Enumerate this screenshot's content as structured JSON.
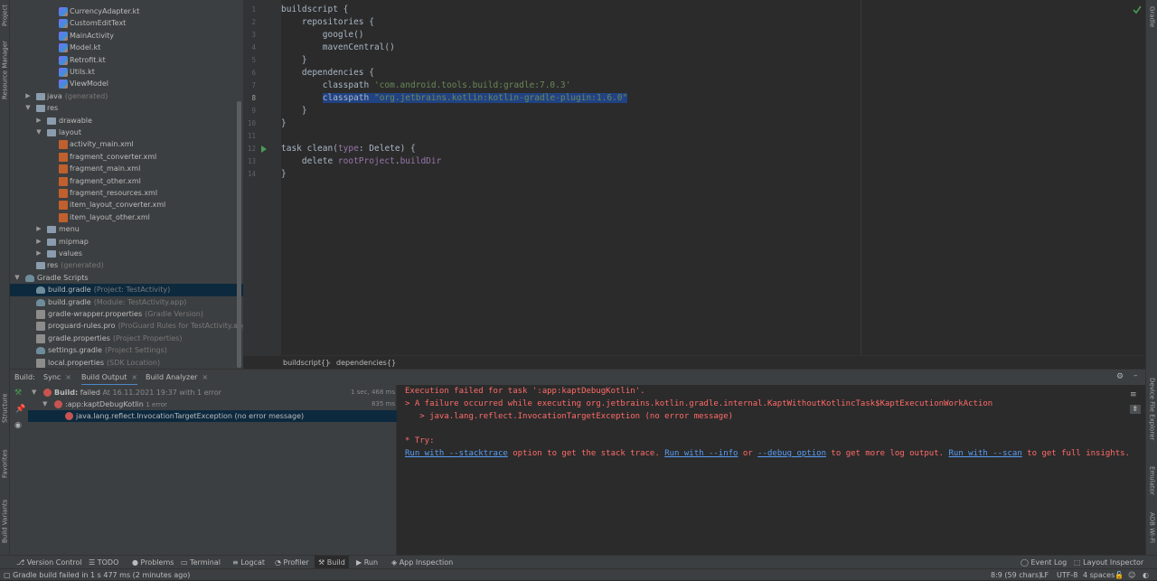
{
  "left_strip": {
    "project_tab": "Project",
    "resource_manager": "Resource Manager",
    "structure": "Structure",
    "favorites": "Favorites",
    "build_variants": "Build Variants"
  },
  "right_strip": {
    "gradle": "Gradle",
    "device_file_explorer": "Device File Explorer",
    "emulator": "Emulator",
    "adb_wifi": "ADB Wi-Fi"
  },
  "tree": [
    {
      "label": "CurrencyAdapter.kt",
      "sub": "",
      "icon": "kotlin-file-icon"
    },
    {
      "label": "CustomEditText",
      "sub": "",
      "icon": "kotlin-file-icon"
    },
    {
      "label": "MainActivity",
      "sub": "",
      "icon": "kotlin-file-icon"
    },
    {
      "label": "Model.kt",
      "sub": "",
      "icon": "kotlin-file-icon"
    },
    {
      "label": "Retrofit.kt",
      "sub": "",
      "icon": "kotlin-file-icon"
    },
    {
      "label": "Utils.kt",
      "sub": "",
      "icon": "kotlin-file-icon"
    },
    {
      "label": "ViewModel",
      "sub": "",
      "icon": "kotlin-file-icon"
    },
    {
      "label": "java",
      "sub": "(generated)",
      "icon": "folder-icon"
    },
    {
      "label": "res",
      "sub": "",
      "icon": "folder-icon"
    },
    {
      "label": "drawable",
      "sub": "",
      "icon": "folder-icon"
    },
    {
      "label": "layout",
      "sub": "",
      "icon": "folder-icon"
    },
    {
      "label": "activity_main.xml",
      "sub": "",
      "icon": "xml-file-icon"
    },
    {
      "label": "fragment_converter.xml",
      "sub": "",
      "icon": "xml-file-icon"
    },
    {
      "label": "fragment_main.xml",
      "sub": "",
      "icon": "xml-file-icon"
    },
    {
      "label": "fragment_other.xml",
      "sub": "",
      "icon": "xml-file-icon"
    },
    {
      "label": "fragment_resources.xml",
      "sub": "",
      "icon": "xml-file-icon"
    },
    {
      "label": "item_layout_converter.xml",
      "sub": "",
      "icon": "xml-file-icon"
    },
    {
      "label": "item_layout_other.xml",
      "sub": "",
      "icon": "xml-file-icon"
    },
    {
      "label": "menu",
      "sub": "",
      "icon": "folder-icon"
    },
    {
      "label": "mipmap",
      "sub": "",
      "icon": "folder-icon"
    },
    {
      "label": "values",
      "sub": "",
      "icon": "folder-icon"
    },
    {
      "label": "res",
      "sub": "(generated)",
      "icon": "folder-icon"
    },
    {
      "label": "Gradle Scripts",
      "sub": "",
      "icon": "gradle-icon"
    },
    {
      "label": "build.gradle",
      "sub": "(Project: TestActivity)",
      "icon": "gradle-icon"
    },
    {
      "label": "build.gradle",
      "sub": "(Module: TestActivity.app)",
      "icon": "gradle-icon"
    },
    {
      "label": "gradle-wrapper.properties",
      "sub": "(Gradle Version)",
      "icon": "properties-file-icon"
    },
    {
      "label": "proguard-rules.pro",
      "sub": "(ProGuard Rules for TestActivity.app)",
      "icon": "properties-file-icon"
    },
    {
      "label": "gradle.properties",
      "sub": "(Project Properties)",
      "icon": "properties-file-icon"
    },
    {
      "label": "settings.gradle",
      "sub": "(Project Settings)",
      "icon": "gradle-icon"
    },
    {
      "label": "local.properties",
      "sub": "(SDK Location)",
      "icon": "properties-file-icon"
    }
  ],
  "editor": {
    "line_numbers": [
      "1",
      "2",
      "3",
      "4",
      "5",
      "6",
      "7",
      "8",
      "9",
      "10",
      "11",
      "12",
      "13",
      "14"
    ],
    "lines": [
      {
        "t1": "buildscript {"
      },
      {
        "t1": "    repositories {"
      },
      {
        "t1": "        google()"
      },
      {
        "t1": "        mavenCentral()"
      },
      {
        "t1": "    }"
      },
      {
        "t1": "    dependencies {"
      },
      {
        "t1": "        classpath ",
        "t2": "'com.android.tools.build:gradle:7.0.3'"
      },
      {
        "t1": "classpath ",
        "t2": "\"org.jetbrains.kotlin:kotlin-gradle-plugin:1.6.0\""
      },
      {
        "t1": "    }"
      },
      {
        "t1": "}"
      },
      {
        "t1": ""
      },
      {
        "t1": "task ",
        "t2": "clean",
        "t3": "(",
        "t4": "type",
        "t5": ": Delete) {"
      },
      {
        "t1": "    delete ",
        "t2": "rootProject",
        "t3": ".",
        "t4": "buildDir"
      },
      {
        "t1": "}"
      }
    ],
    "breadcrumb": [
      "buildscript{}",
      "dependencies{}"
    ]
  },
  "build": {
    "tabs": {
      "build_label": "Build:",
      "sync": "Sync",
      "build_output": "Build Output",
      "build_analyzer": "Build Analyzer"
    },
    "rows": {
      "r1_bold": "Build:",
      "r1_rest": "failed",
      "r1_sub": "At 16.11.2021 19:37 with 1 error",
      "r1_time": "1 sec, 468 ms",
      "r2": ":app:kaptDebugKotlin",
      "r2_sub": "1 error",
      "r2_time": "835 ms",
      "r3": "java.lang.reflect.InvocationTargetException (no error message)"
    },
    "console": {
      "l1": "Execution failed for task ':app:kaptDebugKotlin'.",
      "l2": "> A failure occurred while executing org.jetbrains.kotlin.gradle.internal.KaptWithoutKotlincTask$KaptExecutionWorkAction",
      "l3": "   > java.lang.reflect.InvocationTargetException (no error message)",
      "l4": "* Try:",
      "run_stack": "Run with --stacktrace",
      "t_a": " option to get the stack trace. ",
      "run_info": "Run with --info",
      "t_b": " or ",
      "run_debug": "--debug option",
      "t_c": " to get more log output. ",
      "run_scan": "Run with --scan",
      "t_d": " to get full insights."
    }
  },
  "bottom_bar": {
    "version_control": "Version Control",
    "todo": "TODO",
    "problems": "Problems",
    "terminal": "Terminal",
    "logcat": "Logcat",
    "profiler": "Profiler",
    "build": "Build",
    "run": "Run",
    "app_inspection": "App Inspection",
    "event_log": "Event Log",
    "layout_inspector": "Layout Inspector"
  },
  "status_bar": {
    "message": "Gradle build failed in 1 s 477 ms (2 minutes ago)",
    "position": "8:9 (59 chars)",
    "line_sep": "LF",
    "encoding": "UTF-8",
    "indent": "4 spaces"
  },
  "colors": {
    "error": "#c75450",
    "link": "#589df6",
    "selection": "#214283"
  }
}
